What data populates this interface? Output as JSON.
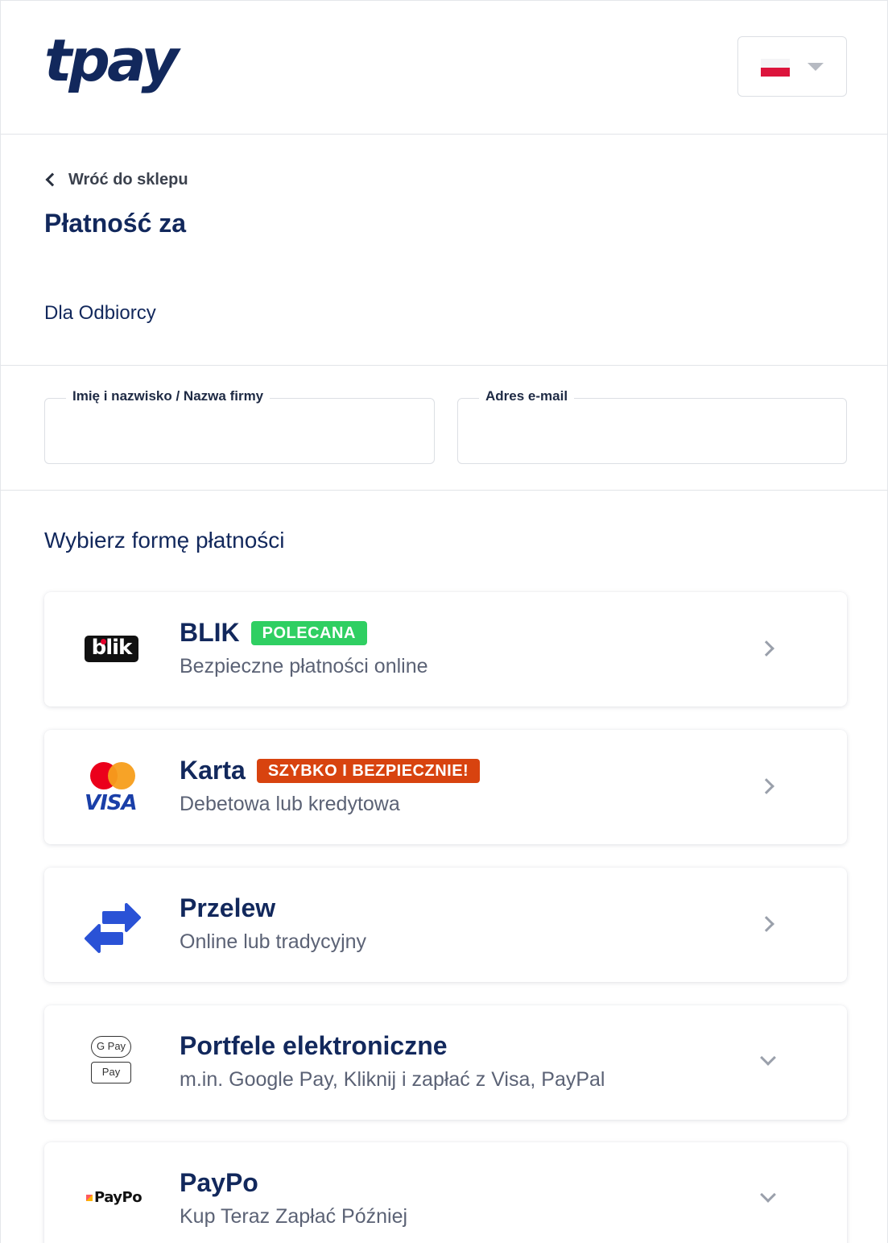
{
  "header": {
    "logo_text": "tpay",
    "language": {
      "flag": "poland-flag",
      "dropdown_icon": "caret-down-icon"
    }
  },
  "nav": {
    "back_label": "Wróć do sklepu"
  },
  "payment": {
    "title": "Płatność za",
    "recipient": "Dla Odbiorcy"
  },
  "form": {
    "name_label": "Imię i nazwisko / Nazwa firmy",
    "name_value": "",
    "email_label": "Adres e-mail",
    "email_value": ""
  },
  "methods_title": "Wybierz formę płatności",
  "methods": [
    {
      "title": "BLIK",
      "badge": "POLECANA",
      "badge_color": "#2fcf62",
      "subtitle": "Bezpieczne płatności online",
      "logo_text": "blik",
      "chevron": "chevron-right-icon"
    },
    {
      "title": "Karta",
      "badge": "SZYBKO I BEZPIECZNIE!",
      "badge_color": "#d8430f",
      "subtitle": "Debetowa lub kredytowa",
      "logo_text": "VISA",
      "chevron": "chevron-right-icon"
    },
    {
      "title": "Przelew",
      "subtitle": "Online lub tradycyjny",
      "chevron": "chevron-right-icon"
    },
    {
      "title": "Portfele elektroniczne",
      "subtitle": "m.in. Google Pay, Kliknij i zapłać z Visa, PayPal",
      "chip1": "G Pay",
      "chip2": " Pay",
      "chevron": "chevron-down-icon"
    },
    {
      "title": "PayPo",
      "subtitle": "Kup Teraz Zapłać Później",
      "logo_text": "PayPo",
      "chevron": "chevron-down-icon"
    }
  ]
}
